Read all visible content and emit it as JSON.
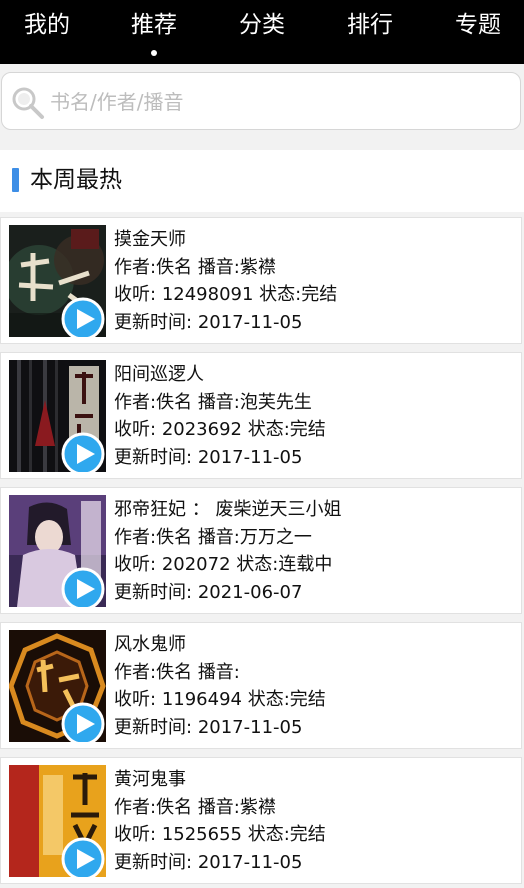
{
  "nav": {
    "tabs": [
      {
        "label": "我的"
      },
      {
        "label": "推荐"
      },
      {
        "label": "分类"
      },
      {
        "label": "排行"
      },
      {
        "label": "专题"
      }
    ],
    "active_index": 1
  },
  "search": {
    "placeholder": "书名/作者/播音",
    "value": ""
  },
  "section": {
    "title": "本周最热"
  },
  "labels": {
    "author": "作者:",
    "narrator": "播音:",
    "listens": "收听:",
    "status": "状态:",
    "updated": "更新时间:"
  },
  "books": [
    {
      "title": "摸金天师",
      "author": "佚名",
      "narrator": "紫襟",
      "listens": "12498091",
      "status": "完结",
      "updated": "2017-11-05"
    },
    {
      "title": "阳间巡逻人",
      "author": "佚名",
      "narrator": "泡芙先生",
      "listens": "2023692",
      "status": "完结",
      "updated": "2017-11-05"
    },
    {
      "title": "邪帝狂妃 ： 废柴逆天三小姐",
      "author": "佚名",
      "narrator": "万万之一",
      "listens": "202072",
      "status": "连载中",
      "updated": "2021-06-07"
    },
    {
      "title": "风水鬼师",
      "author": "佚名",
      "narrator": "",
      "listens": "1196494",
      "status": "完结",
      "updated": "2017-11-05"
    },
    {
      "title": "黄河鬼事",
      "author": "佚名",
      "narrator": "紫襟",
      "listens": "1525655",
      "status": "完结",
      "updated": "2017-11-05"
    }
  ],
  "theme": {
    "nav_bg": "#000000",
    "accent": "#3d8ee6",
    "play_button": "#2fa8ee"
  }
}
